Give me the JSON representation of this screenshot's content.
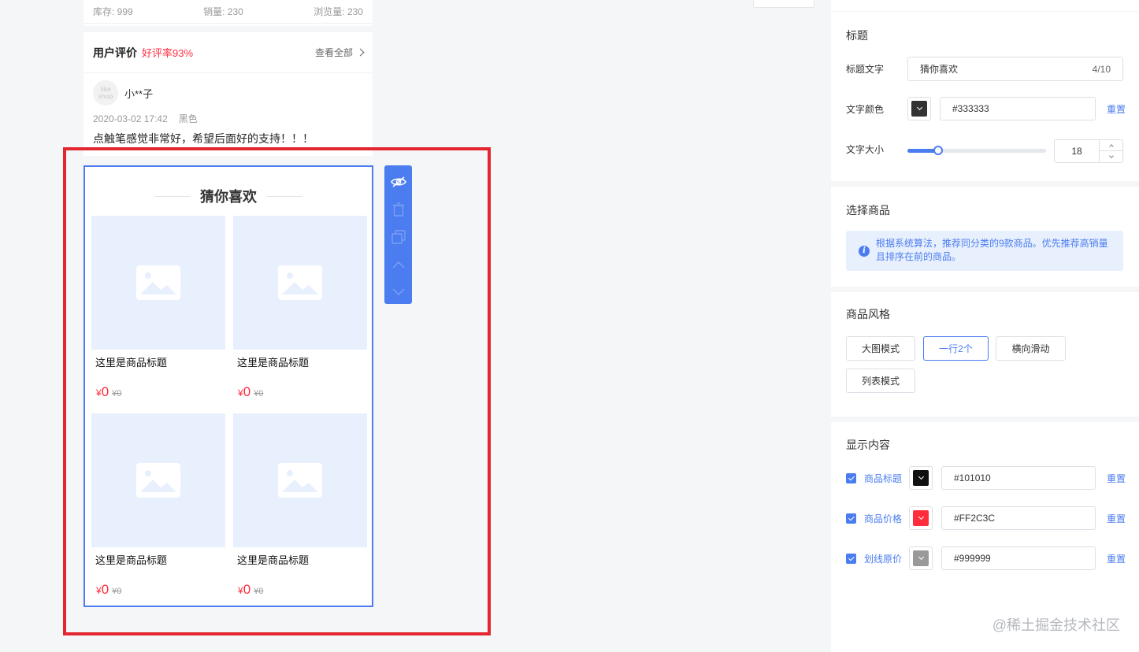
{
  "product_stats": {
    "stock": "库存: 999",
    "sales": "销量: 230",
    "views": "浏览量: 230"
  },
  "review": {
    "title": "用户评价",
    "rate": "好评率93%",
    "view_all": "查看全部",
    "reviewer_name": "小**子",
    "avatar_text_1": "like",
    "avatar_text_2": "shop",
    "date": "2020-03-02 17:42",
    "spec": "黑色",
    "content": "点触笔感觉非常好，希望后面好的支持！！！"
  },
  "guess": {
    "title": "猜你喜欢",
    "products": [
      {
        "title": "这里是商品标题",
        "price": "0",
        "original_price": "¥0"
      },
      {
        "title": "这里是商品标题",
        "price": "0",
        "original_price": "¥0"
      },
      {
        "title": "这里是商品标题",
        "price": "0",
        "original_price": "¥0"
      },
      {
        "title": "这里是商品标题",
        "price": "0",
        "original_price": "¥0"
      }
    ],
    "currency": "¥"
  },
  "toolbar_icons": [
    "eye-off-icon",
    "trash-icon",
    "copy-icon",
    "chevron-up-icon",
    "chevron-down-icon"
  ],
  "panel": {
    "title_section": {
      "heading": "标题",
      "title_text_label": "标题文字",
      "title_text_value": "猜你喜欢",
      "title_text_count": "4/10",
      "text_color_label": "文字颜色",
      "text_color_value": "#333333",
      "reset": "重置",
      "font_size_label": "文字大小",
      "font_size_value": "18",
      "font_size_fraction": 0.22
    },
    "select_section": {
      "heading": "选择商品",
      "info_line_1": "根据系统算法，推荐同分类的9款商品。优先推荐高销量",
      "info_line_2": "且排序在前的商品。"
    },
    "style_section": {
      "heading": "商品风格",
      "options": [
        "大图模式",
        "一行2个",
        "横向滑动",
        "列表模式"
      ],
      "selected": "一行2个"
    },
    "display_section": {
      "heading": "显示内容",
      "items": [
        {
          "label": "商品标题",
          "color": "#101010",
          "reset": "重置",
          "checked": true
        },
        {
          "label": "商品价格",
          "color": "#FF2C3C",
          "reset": "重置",
          "checked": true
        },
        {
          "label": "划线原价",
          "color": "#999999",
          "reset": "重置",
          "checked": true
        }
      ]
    }
  },
  "watermark": "@稀土掘金技术社区",
  "colors": {
    "accent": "#4b7cf0",
    "price": "#ff2c3c",
    "highlight_frame": "#e3262f"
  }
}
